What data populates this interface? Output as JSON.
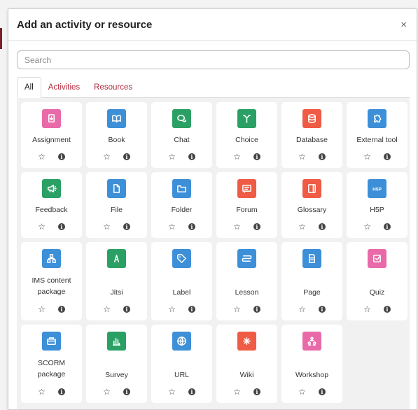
{
  "dialog": {
    "title": "Add an activity or resource",
    "close_glyph": "×"
  },
  "search": {
    "placeholder": "Search",
    "value": ""
  },
  "tabs": [
    {
      "label": "All",
      "active": true
    },
    {
      "label": "Activities",
      "active": false
    },
    {
      "label": "Resources",
      "active": false
    }
  ],
  "colors": {
    "pink": "#e96aa8",
    "blue": "#3d8fd8",
    "green": "#2ba064",
    "red": "#ef5b45",
    "tab_link": "#b0283a"
  },
  "glyphs": {
    "star": "☆",
    "info": "i"
  },
  "modules": [
    {
      "label": "Assignment",
      "icon": "assignment-icon",
      "color": "pink"
    },
    {
      "label": "Book",
      "icon": "book-icon",
      "color": "blue"
    },
    {
      "label": "Chat",
      "icon": "chat-icon",
      "color": "green"
    },
    {
      "label": "Choice",
      "icon": "choice-icon",
      "color": "green"
    },
    {
      "label": "Database",
      "icon": "database-icon",
      "color": "red"
    },
    {
      "label": "External tool",
      "icon": "puzzle-icon",
      "color": "blue"
    },
    {
      "label": "Feedback",
      "icon": "megaphone-icon",
      "color": "green"
    },
    {
      "label": "File",
      "icon": "file-icon",
      "color": "blue"
    },
    {
      "label": "Folder",
      "icon": "folder-icon",
      "color": "blue"
    },
    {
      "label": "Forum",
      "icon": "forum-icon",
      "color": "red"
    },
    {
      "label": "Glossary",
      "icon": "glossary-icon",
      "color": "red"
    },
    {
      "label": "H5P",
      "icon": "h5p-icon",
      "color": "blue"
    },
    {
      "label": "IMS content package",
      "icon": "package-icon",
      "color": "blue"
    },
    {
      "label": "Jitsi",
      "icon": "jitsi-icon",
      "color": "green"
    },
    {
      "label": "Label",
      "icon": "tag-icon",
      "color": "blue"
    },
    {
      "label": "Lesson",
      "icon": "lesson-icon",
      "color": "blue"
    },
    {
      "label": "Page",
      "icon": "page-icon",
      "color": "blue"
    },
    {
      "label": "Quiz",
      "icon": "quiz-icon",
      "color": "pink"
    },
    {
      "label": "SCORM package",
      "icon": "scorm-icon",
      "color": "blue"
    },
    {
      "label": "Survey",
      "icon": "survey-icon",
      "color": "green"
    },
    {
      "label": "URL",
      "icon": "globe-icon",
      "color": "blue"
    },
    {
      "label": "Wiki",
      "icon": "wiki-icon",
      "color": "red"
    },
    {
      "label": "Workshop",
      "icon": "workshop-icon",
      "color": "pink"
    }
  ]
}
